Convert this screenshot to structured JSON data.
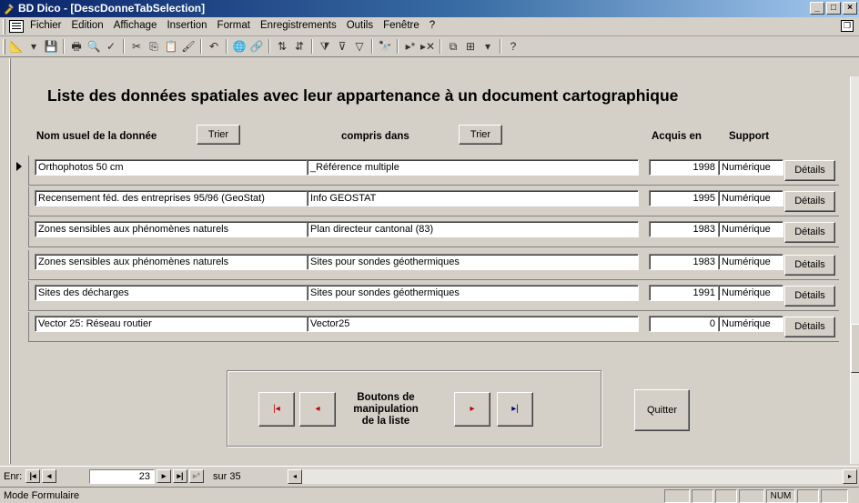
{
  "window": {
    "title": "BD Dico - [DescDonneTabSelection]"
  },
  "menu": [
    "Fichier",
    "Edition",
    "Affichage",
    "Insertion",
    "Format",
    "Enregistrements",
    "Outils",
    "Fenêtre",
    "?"
  ],
  "form": {
    "title": "Liste des données spatiales avec leur appartenance à un document cartographique",
    "col_name": "Nom usuel de la donnée",
    "col_doc": "compris dans",
    "col_year": "Acquis en",
    "col_support": "Support",
    "sort_label": "Trier",
    "details_label": "Détails",
    "rows": [
      {
        "name": "Orthophotos 50 cm",
        "doc": "_Référence multiple",
        "year": "1998",
        "support": "Numérique"
      },
      {
        "name": "Recensement féd. des entreprises 95/96 (GeoStat)",
        "doc": "Info GEOSTAT",
        "year": "1995",
        "support": "Numérique"
      },
      {
        "name": "Zones sensibles aux phénomènes naturels",
        "doc": "Plan directeur cantonal (83)",
        "year": "1983",
        "support": "Numérique"
      },
      {
        "name": "Zones sensibles aux phénomènes naturels",
        "doc": "Sites pour sondes géothermiques",
        "year": "1983",
        "support": "Numérique"
      },
      {
        "name": "Sites des décharges",
        "doc": "Sites pour sondes géothermiques",
        "year": "1991",
        "support": "Numérique"
      },
      {
        "name": "Vector 25: Réseau routier",
        "doc": "Vector25",
        "year": "0",
        "support": "Numérique"
      }
    ],
    "nav_label_1": "Boutons de",
    "nav_label_2": "manipulation",
    "nav_label_3": "de la liste",
    "quit_label": "Quitter"
  },
  "record_nav": {
    "label": "Enr:",
    "current": "23",
    "of_label": "sur 35"
  },
  "status": {
    "mode": "Mode Formulaire",
    "num": "NUM"
  }
}
